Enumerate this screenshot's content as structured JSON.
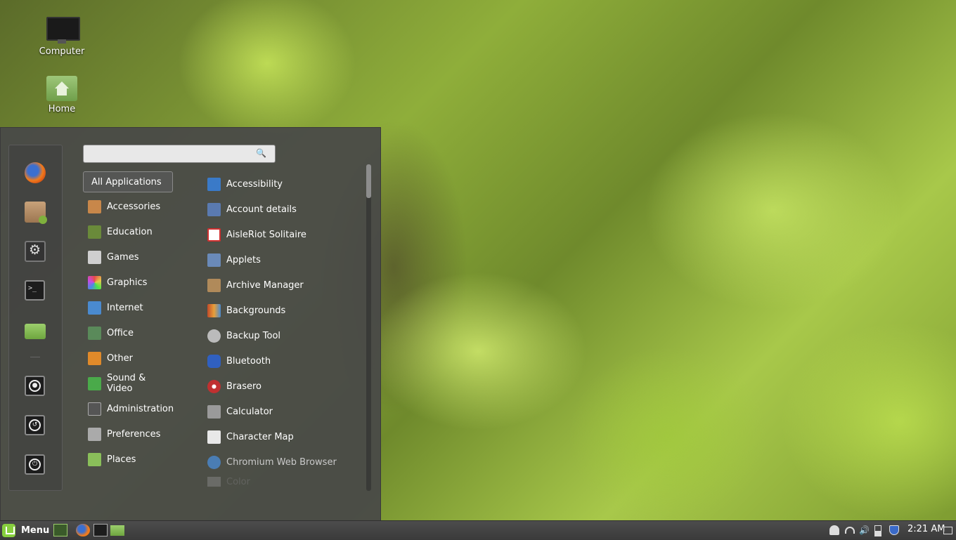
{
  "desktop": {
    "icons": [
      {
        "label": "Computer"
      },
      {
        "label": "Home"
      }
    ]
  },
  "menu": {
    "search": {
      "placeholder": "",
      "value": ""
    },
    "favorites": [
      {
        "name": "firefox"
      },
      {
        "name": "software-manager"
      },
      {
        "name": "system-settings"
      },
      {
        "name": "terminal"
      },
      {
        "name": "files"
      },
      {
        "name": "lock-screen"
      },
      {
        "name": "logout"
      },
      {
        "name": "shutdown"
      }
    ],
    "categories": [
      {
        "label": "All Applications",
        "selected": true
      },
      {
        "label": "Accessories",
        "color": "#c8874a"
      },
      {
        "label": "Education",
        "color": "#6a8a3a"
      },
      {
        "label": "Games",
        "color": "#cfcfcf"
      },
      {
        "label": "Graphics",
        "color": "#e64a8a"
      },
      {
        "label": "Internet",
        "color": "#4a8acf"
      },
      {
        "label": "Office",
        "color": "#5a8a5a"
      },
      {
        "label": "Other",
        "color": "#e08a2a"
      },
      {
        "label": "Sound & Video",
        "color": "#4aaa4a"
      },
      {
        "label": "Administration",
        "color": "#555555"
      },
      {
        "label": "Preferences",
        "color": "#aaaaaa"
      },
      {
        "label": "Places",
        "color": "#8abf5a"
      }
    ],
    "applications": [
      {
        "label": "Accessibility",
        "color": "#3a7ac8"
      },
      {
        "label": "Account details",
        "color": "#5a7ab0"
      },
      {
        "label": "AisleRiot Solitaire",
        "color": "#d03030"
      },
      {
        "label": "Applets",
        "color": "#6a8ab8"
      },
      {
        "label": "Archive Manager",
        "color": "#b08a5a"
      },
      {
        "label": "Backgrounds",
        "color": "#c04a2a"
      },
      {
        "label": "Backup Tool",
        "color": "#bbbbbb"
      },
      {
        "label": "Bluetooth",
        "color": "#3060c0"
      },
      {
        "label": "Brasero",
        "color": "#c03030"
      },
      {
        "label": "Calculator",
        "color": "#9a9a9a"
      },
      {
        "label": "Character Map",
        "color": "#e8e8e8"
      },
      {
        "label": "Chromium Web Browser",
        "color": "#4a8acf"
      },
      {
        "label": "Color",
        "color": "#888888"
      }
    ]
  },
  "panel": {
    "menu_label": "Menu",
    "clock": "2:21 AM"
  }
}
